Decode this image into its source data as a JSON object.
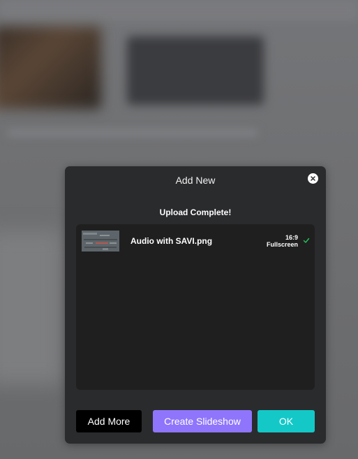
{
  "modal": {
    "title": "Add New",
    "close_icon": "close-icon",
    "status": "Upload Complete!",
    "files": [
      {
        "name": "Audio with SAVI.png",
        "ratio": "16:9",
        "mode": "Fullscreen",
        "status_icon": "checkmark-icon"
      }
    ],
    "buttons": {
      "add_more": "Add More",
      "create_slideshow": "Create Slideshow",
      "ok": "OK"
    }
  },
  "colors": {
    "modal_bg": "#2a2b2d",
    "list_bg": "#1f1f1f",
    "create_slideshow": "#8f75fb",
    "ok": "#14c8c8",
    "add_more": "#000000",
    "check": "#22c55e"
  }
}
